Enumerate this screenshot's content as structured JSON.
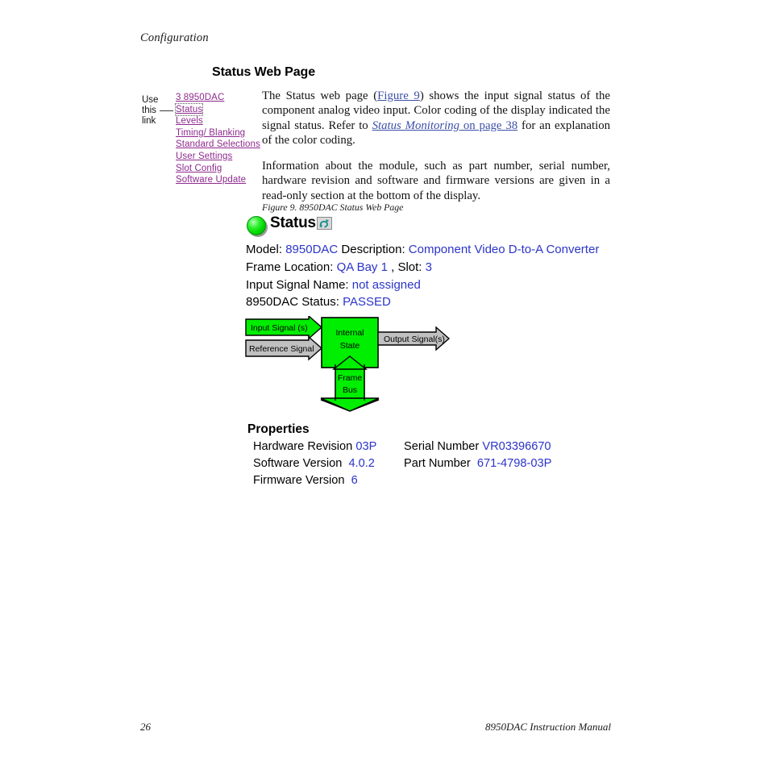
{
  "document": {
    "running_head": "Configuration",
    "section_heading": "Status Web Page",
    "footer_page_number": "26",
    "footer_title": "8950DAC Instruction Manual",
    "figure_caption": "Figure 9.  8950DAC Status Web Page"
  },
  "margin_note": {
    "line1": "Use",
    "line2": "this",
    "line3": "link"
  },
  "sidebar": {
    "items": [
      {
        "label": "3 8950DAC",
        "focused": false
      },
      {
        "label": "Status",
        "focused": true
      },
      {
        "label": "Levels",
        "focused": false
      },
      {
        "label": "Timing/ Blanking",
        "focused": false
      },
      {
        "label": "Standard Selections",
        "focused": false
      },
      {
        "label": "User Settings",
        "focused": false
      },
      {
        "label": "Slot Config",
        "focused": false
      },
      {
        "label": "Software Update",
        "focused": false
      }
    ],
    "link_color": "#8e2a8e"
  },
  "body": {
    "p1_a": "The Status web page (",
    "p1_link1": "Figure 9",
    "p1_b": ") shows the input signal status of the component analog video input. Color coding of the display indicated the signal status. Refer to ",
    "p1_link2": "Status Monitoring",
    "p1_link3": " on page 38",
    "p1_c": " for an explanation of the color coding.",
    "p2": "Information about the module, such as part number, serial number, hardware revision and software and firmware versions are given in a read-only section at the bottom of the display."
  },
  "webpage": {
    "title": "Status",
    "led_color": "#00d900",
    "refresh_icon": "refresh-icon",
    "fields": {
      "model_label": "Model:",
      "model_value": "8950DAC",
      "description_label": "Description:",
      "description_value": "Component Video D-to-A Converter",
      "frame_location_label": "Frame Location:",
      "frame_location_value": "QA Bay 1",
      "slot_label": ", Slot:",
      "slot_value": "3",
      "input_signal_name_label": "Input Signal Name:",
      "input_signal_name_value": "not assigned",
      "status_label": "8950DAC Status:",
      "status_value": "PASSED"
    },
    "diagram": {
      "input_signal": "Input Signal (s)",
      "reference_signal": "Reference Signal",
      "internal_state_line1": "Internal",
      "internal_state_line2": "State",
      "output_signal": "Output Signal(s)",
      "frame_bus_line1": "Frame",
      "frame_bus_line2": "Bus",
      "colors": {
        "active_green": "#00ee00",
        "inactive_gray": "#bfbfbf"
      }
    },
    "properties": {
      "title": "Properties",
      "left": [
        {
          "label": "Hardware Revision",
          "value": "03P"
        },
        {
          "label": "Software Version",
          "value": "4.0.2"
        },
        {
          "label": "Firmware Version",
          "value": "6"
        }
      ],
      "right": [
        {
          "label": "Serial Number",
          "value": "VR03396670"
        },
        {
          "label": "Part Number",
          "value": "671-4798-03P"
        }
      ]
    }
  }
}
